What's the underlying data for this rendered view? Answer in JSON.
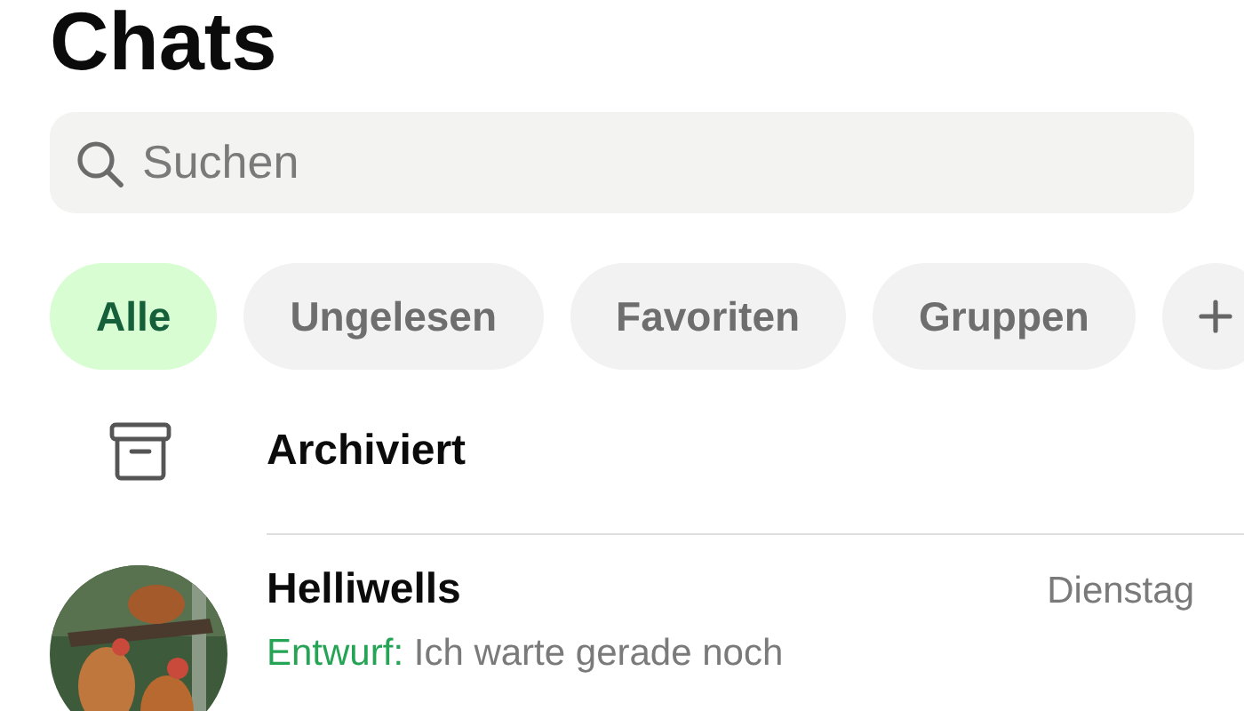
{
  "title": "Chats",
  "search": {
    "placeholder": "Suchen"
  },
  "filters": [
    {
      "kind": "filter",
      "label": "Alle",
      "selected": true
    },
    {
      "kind": "filter",
      "label": "Ungelesen",
      "selected": false
    },
    {
      "kind": "filter",
      "label": "Favoriten",
      "selected": false
    },
    {
      "kind": "filter",
      "label": "Gruppen",
      "selected": false
    },
    {
      "kind": "add"
    }
  ],
  "archived": {
    "label": "Archiviert"
  },
  "chats": [
    {
      "name": "Helliwells",
      "time": "Dienstag",
      "draft_label": "Entwurf:",
      "message": "Ich warte gerade noch"
    }
  ]
}
